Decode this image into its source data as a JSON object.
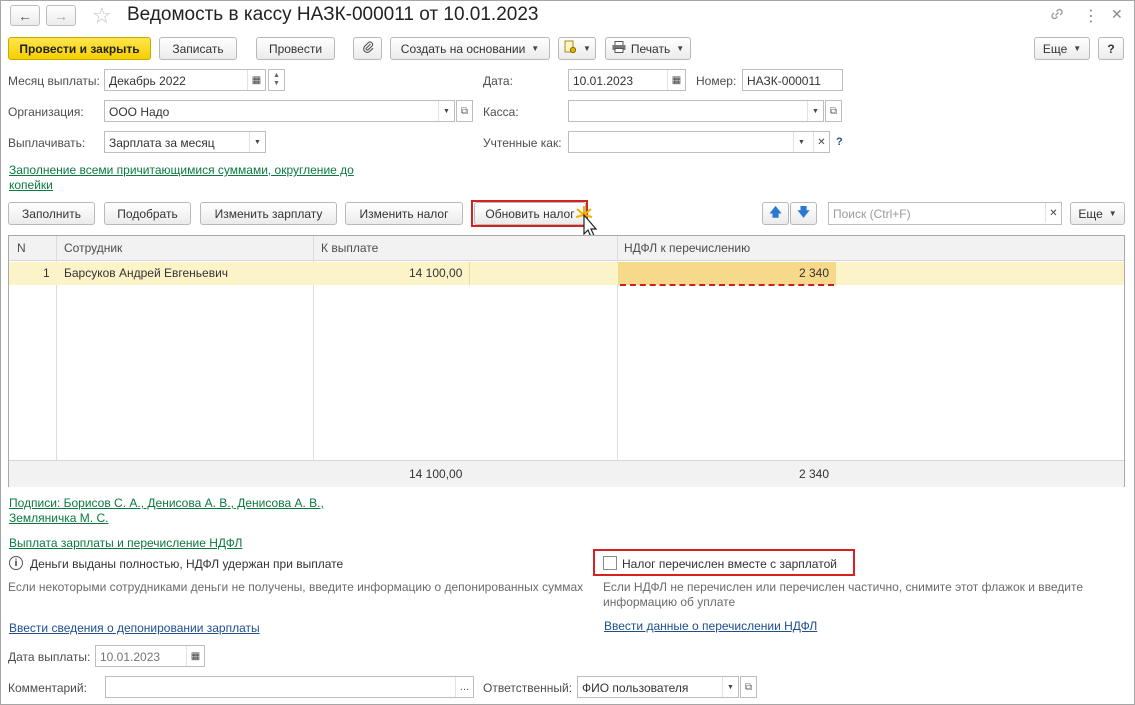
{
  "window": {
    "title": "Ведомость в кассу НАЗК-000011 от 10.01.2023"
  },
  "toolbar": {
    "post_close": "Провести и закрыть",
    "save": "Записать",
    "post": "Провести",
    "create_based": "Создать на основании",
    "print": "Печать",
    "more": "Еще",
    "help": "?"
  },
  "form": {
    "month_label": "Месяц выплаты:",
    "month_value": "Декабрь 2022",
    "date_label": "Дата:",
    "date_value": "10.01.2023",
    "number_label": "Номер:",
    "number_value": "НАЗК-000011",
    "org_label": "Организация:",
    "org_value": "ООО Надо",
    "cash_label": "Касса:",
    "cash_value": "",
    "pay_label": "Выплачивать:",
    "pay_value": "Зарплата за месяц",
    "accounted_label": "Учтенные как:",
    "accounted_value": "",
    "accounted_help": "?"
  },
  "links": {
    "fill_all_line1": "Заполнение всеми причитающимися суммами, округление до",
    "fill_all_line2": "копейки",
    "signatures_line1": "Подписи: Борисов С. А., Денисова А. В., Денисова А. В.,",
    "signatures_line2": "Земляничка М. С.",
    "payout_ndfl": "Выплата зарплаты и перечисление НДФЛ",
    "deposit_info": "Ввести сведения о депонировании зарплаты",
    "ndfl_transfer": "Ввести данные о перечислении НДФЛ"
  },
  "table_toolbar": {
    "fill": "Заполнить",
    "pick": "Подобрать",
    "change_salary": "Изменить зарплату",
    "change_tax": "Изменить налог",
    "update_tax": "Обновить налог",
    "search_placeholder": "Поиск (Ctrl+F)",
    "more": "Еще"
  },
  "table": {
    "columns": [
      "N",
      "Сотрудник",
      "К выплате",
      "НДФЛ к перечислению"
    ],
    "rows": [
      {
        "n": "1",
        "employee": "Барсуков Андрей Евгеньевич",
        "to_pay": "14 100,00",
        "ndfl": "2 340"
      }
    ],
    "totals": {
      "to_pay": "14 100,00",
      "ndfl": "2 340"
    }
  },
  "status": {
    "info_text": "Деньги выданы полностью, НДФЛ удержан при выплате",
    "info_hint": "Если некоторыми сотрудниками деньги не получены, введите информацию о депонированных суммах",
    "tax_checkbox_label": "Налог перечислен вместе с зарплатой",
    "tax_checkbox_checked": false,
    "tax_hint_line1": "Если НДФЛ не перечислен или перечислен частично, снимите этот флажок и введите",
    "tax_hint_line2": "информацию об уплате"
  },
  "bottom": {
    "pay_date_label": "Дата выплаты:",
    "pay_date_value": "10.01.2023",
    "comment_label": "Комментарий:",
    "comment_value": "",
    "responsible_label": "Ответственный:",
    "responsible_value": "ФИО пользователя"
  },
  "colors": {
    "primary_button": "#f5cf00",
    "link_green": "#0a7a3f",
    "link_blue": "#1f4e8c",
    "highlight_row": "#fcf3c8",
    "highlight_box": "#d92020"
  }
}
